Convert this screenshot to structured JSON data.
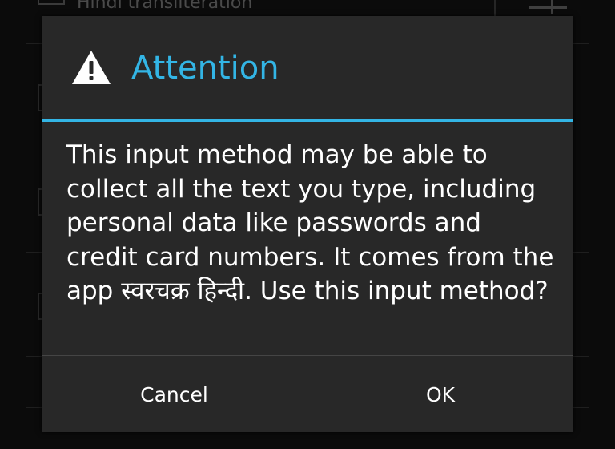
{
  "background": {
    "list_item_title": "Hindi transliteration"
  },
  "dialog": {
    "title": "Attention",
    "icon": "warning-icon",
    "message": "This input method may be able to collect all the text you type, including personal data like passwords and credit card numbers. It comes from the app स्वरचक्र हिन्दी. Use this input method?",
    "buttons": {
      "cancel": "Cancel",
      "ok": "OK"
    }
  },
  "colors": {
    "accent": "#33b5e5",
    "dialog_background": "#282828",
    "text": "#ffffff",
    "screen_background": "#0b0b0b"
  }
}
